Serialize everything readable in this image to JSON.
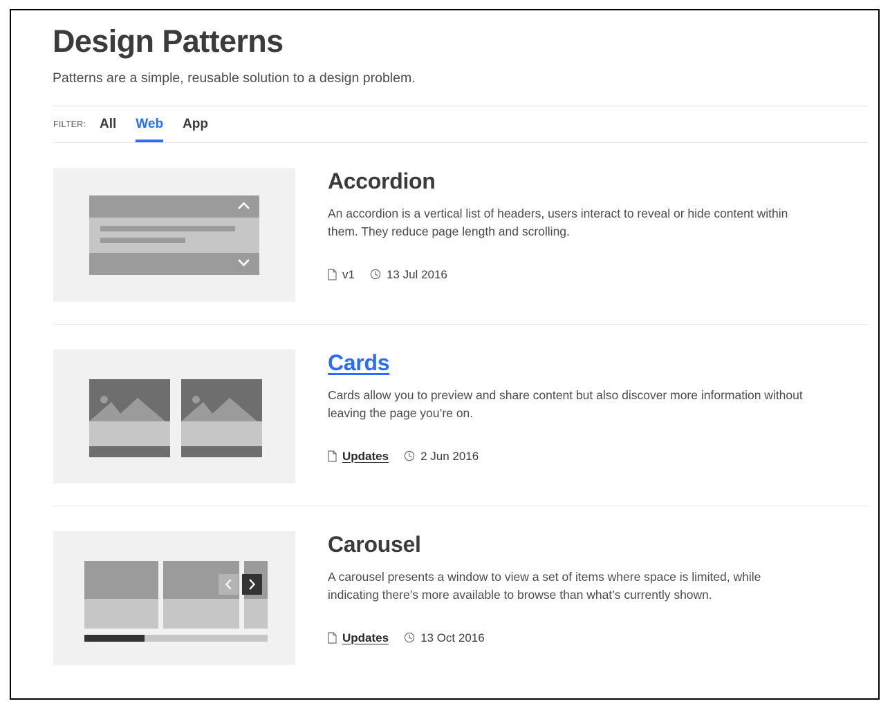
{
  "header": {
    "title": "Design Patterns",
    "subtitle": "Patterns are a simple, reusable solution to a design problem."
  },
  "filter": {
    "label": "FILTER:",
    "items": [
      {
        "label": "All",
        "active": false
      },
      {
        "label": "Web",
        "active": true
      },
      {
        "label": "App",
        "active": false
      }
    ],
    "active_color": "#2b6df7"
  },
  "patterns": [
    {
      "name": "Accordion",
      "is_link": false,
      "description": "An accordion is a vertical list of headers, users interact to reveal or hide content within them. They reduce page length and scrolling.",
      "version_icon": "document-icon",
      "version": "v1",
      "date_icon": "clock-icon",
      "date": "13 Jul 2016",
      "version_is_link": false,
      "thumbnail": "accordion-wireframe"
    },
    {
      "name": "Cards",
      "is_link": true,
      "description": "Cards allow you to preview and share content but also discover more information without leaving the page you’re on.",
      "version_icon": "document-icon",
      "version": "Updates",
      "date_icon": "clock-icon",
      "date": "2 Jun 2016",
      "version_is_link": true,
      "thumbnail": "cards-wireframe"
    },
    {
      "name": "Carousel",
      "is_link": false,
      "description": "A carousel presents a window to view a set of items where space is limited, while indicating there’s more available to browse than what’s currently shown.",
      "version_icon": "document-icon",
      "version": "Updates",
      "date_icon": "clock-icon",
      "date": "13 Oct 2016",
      "version_is_link": true,
      "thumbnail": "carousel-wireframe"
    }
  ],
  "thumbnail_art": {
    "accordion": {
      "chevron_up": "⌃",
      "chevron_down": "⌄"
    },
    "carousel": {
      "prev_arrow": "‹",
      "next_arrow": "›",
      "progress_percent": 33
    }
  }
}
